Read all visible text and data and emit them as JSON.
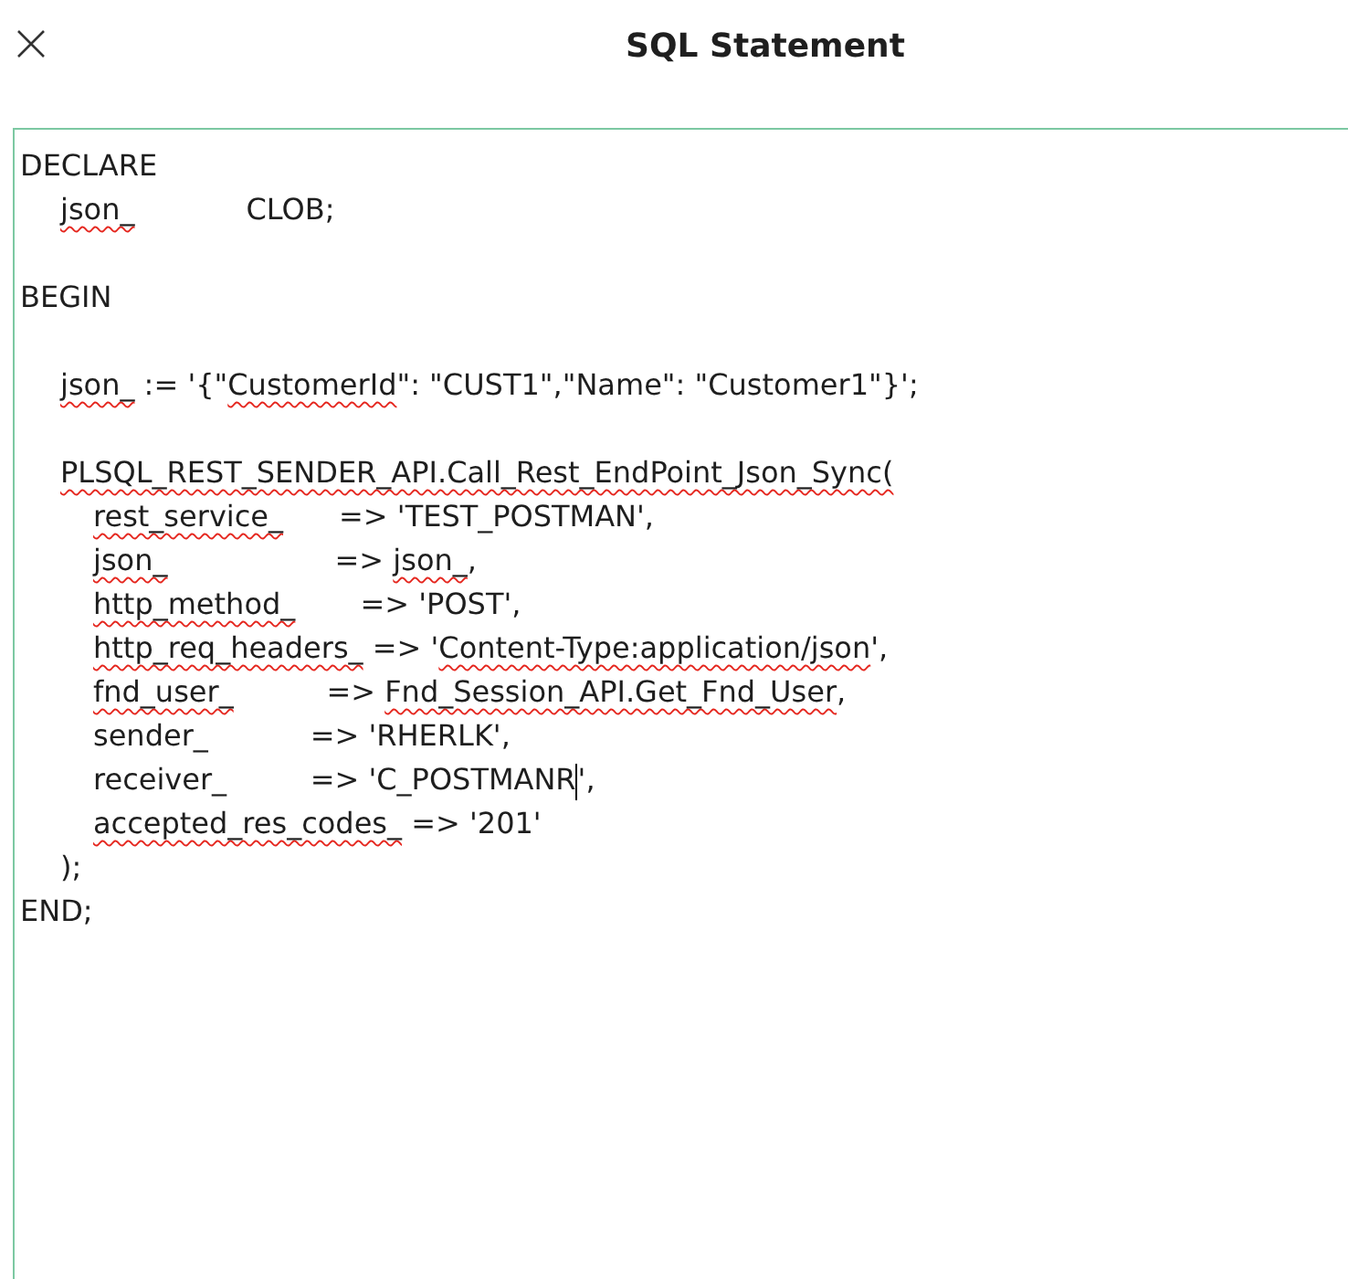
{
  "dialog": {
    "title": "SQL Statement"
  },
  "editor": {
    "lines": [
      {
        "kind": "code",
        "segments": [
          {
            "kind": "text",
            "text": "DECLARE",
            "misspelled": false
          }
        ],
        "children": [
          {
            "kind": "code",
            "segments": [
              {
                "kind": "text",
                "text": "json_",
                "misspelled": true
              },
              {
                "kind": "text",
                "text": "            CLOB;",
                "misspelled": false
              }
            ]
          }
        ]
      },
      {
        "kind": "blank"
      },
      {
        "kind": "code",
        "segments": [
          {
            "kind": "text",
            "text": "BEGIN",
            "misspelled": false
          }
        ],
        "children": [
          {
            "kind": "blank"
          },
          {
            "kind": "code",
            "segments": [
              {
                "kind": "text",
                "text": "json_",
                "misspelled": true
              },
              {
                "kind": "text",
                "text": " := '{\"",
                "misspelled": false
              },
              {
                "kind": "text",
                "text": "CustomerId",
                "misspelled": true
              },
              {
                "kind": "text",
                "text": "\": \"CUST1\",\"Name\": \"Customer1\"}';",
                "misspelled": false
              }
            ]
          },
          {
            "kind": "blank"
          },
          {
            "kind": "code",
            "segments": [
              {
                "kind": "text",
                "text": "PLSQL_REST_SENDER_API.Call_Rest_EndPoint_Json_Sync(",
                "misspelled": true
              }
            ],
            "children": [
              {
                "kind": "code",
                "segments": [
                  {
                    "kind": "text",
                    "text": "rest_service_",
                    "misspelled": true
                  },
                  {
                    "kind": "text",
                    "text": "      => 'TEST_POSTMAN',",
                    "misspelled": false
                  }
                ]
              },
              {
                "kind": "code",
                "segments": [
                  {
                    "kind": "text",
                    "text": "json_",
                    "misspelled": true
                  },
                  {
                    "kind": "text",
                    "text": "                  => ",
                    "misspelled": false
                  },
                  {
                    "kind": "text",
                    "text": "json_",
                    "misspelled": true
                  },
                  {
                    "kind": "text",
                    "text": ",",
                    "misspelled": false
                  }
                ]
              },
              {
                "kind": "code",
                "segments": [
                  {
                    "kind": "text",
                    "text": "http_method_",
                    "misspelled": true
                  },
                  {
                    "kind": "text",
                    "text": "       => 'POST',",
                    "misspelled": false
                  }
                ]
              },
              {
                "kind": "code",
                "segments": [
                  {
                    "kind": "text",
                    "text": "http_req_headers_",
                    "misspelled": true
                  },
                  {
                    "kind": "text",
                    "text": " => '",
                    "misspelled": false
                  },
                  {
                    "kind": "text",
                    "text": "Content-Type:application/json",
                    "misspelled": true
                  },
                  {
                    "kind": "text",
                    "text": "',",
                    "misspelled": false
                  }
                ]
              },
              {
                "kind": "code",
                "segments": [
                  {
                    "kind": "text",
                    "text": "fnd_user_",
                    "misspelled": true
                  },
                  {
                    "kind": "text",
                    "text": "          => ",
                    "misspelled": false
                  },
                  {
                    "kind": "text",
                    "text": "Fnd_Session_API.Get_Fnd_User",
                    "misspelled": true
                  },
                  {
                    "kind": "text",
                    "text": ",",
                    "misspelled": false
                  }
                ]
              },
              {
                "kind": "code",
                "segments": [
                  {
                    "kind": "text",
                    "text": "sender_",
                    "misspelled": false
                  },
                  {
                    "kind": "text",
                    "text": "           => 'RHERLK',",
                    "misspelled": false
                  }
                ]
              },
              {
                "kind": "code",
                "segments": [
                  {
                    "kind": "text",
                    "text": "receiver_",
                    "misspelled": false
                  },
                  {
                    "kind": "text",
                    "text": "         => 'C_POSTMANR",
                    "misspelled": false
                  },
                  {
                    "kind": "caret"
                  },
                  {
                    "kind": "text",
                    "text": "',",
                    "misspelled": false
                  }
                ]
              },
              {
                "kind": "code",
                "segments": [
                  {
                    "kind": "text",
                    "text": "accepted_res_codes_",
                    "misspelled": true
                  },
                  {
                    "kind": "text",
                    "text": " => '201'",
                    "misspelled": false
                  }
                ]
              }
            ]
          },
          {
            "kind": "code",
            "segments": [
              {
                "kind": "text",
                "text": ");",
                "misspelled": false
              }
            ]
          }
        ]
      },
      {
        "kind": "code",
        "segments": [
          {
            "kind": "text",
            "text": "END;",
            "misspelled": false
          }
        ]
      }
    ]
  }
}
